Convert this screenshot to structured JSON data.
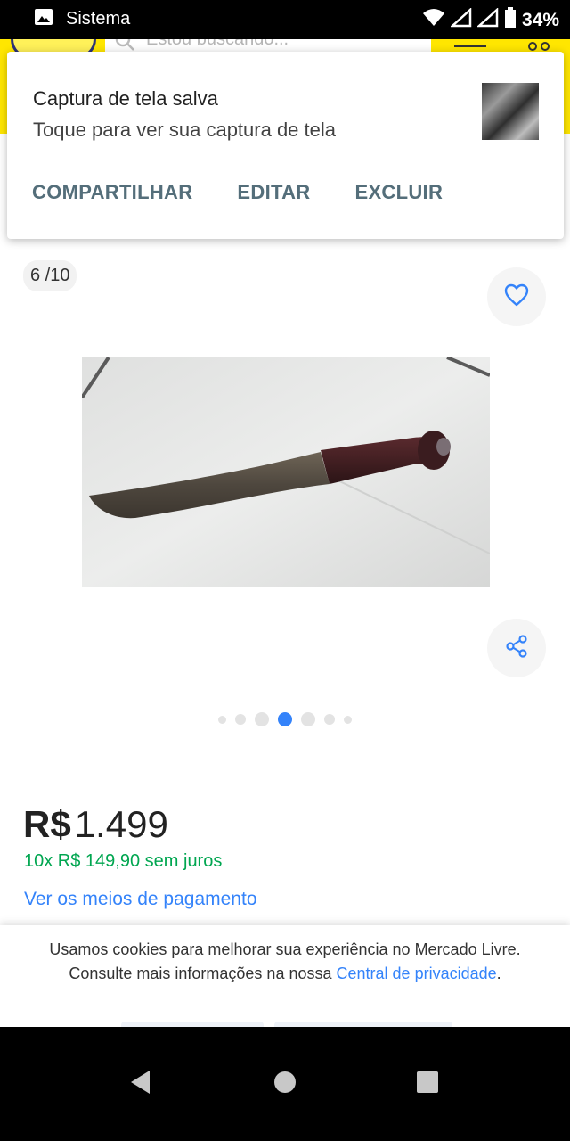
{
  "status_bar": {
    "title": "Sistema",
    "battery": "34%"
  },
  "header": {
    "search_placeholder": "Estou buscando..."
  },
  "notification": {
    "title": "Captura de tela salva",
    "text": "Toque para ver sua captura de tela",
    "actions": [
      {
        "label": "COMPARTILHAR"
      },
      {
        "label": "EDITAR"
      },
      {
        "label": "EXCLUIR"
      }
    ]
  },
  "gallery": {
    "counter": "6 /10",
    "current_dot_index": 3,
    "dot_count": 7
  },
  "product": {
    "price_currency": "R$",
    "price_value": "1.499",
    "installments": "10x R$ 149,90 sem juros",
    "payment_link": "Ver os meios de pagamento"
  },
  "cookie_banner": {
    "text": "Usamos cookies para melhorar sua experiência no Mercado Livre. Consulte mais informações na nossa",
    "link": "Central de privacidade",
    "link_suffix": "."
  },
  "colors": {
    "brand_yellow": "#ffe600",
    "link_blue": "#3483fa",
    "installment_green": "#00a650",
    "active_dot": "#3483fa"
  }
}
